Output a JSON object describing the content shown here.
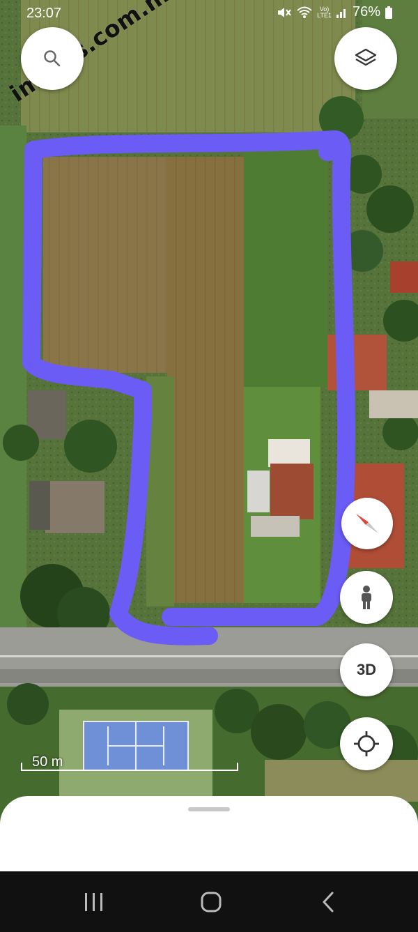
{
  "status_bar": {
    "time": "23:07",
    "battery_percent": "76%",
    "network_label_top": "Vo)",
    "network_label_bottom": "LTE1",
    "icons": [
      "mute-icon",
      "wifi-icon",
      "volte-icon",
      "signal-icon",
      "battery-icon"
    ]
  },
  "watermark": {
    "text": "impuls.com.mk"
  },
  "map": {
    "type": "satellite",
    "outline_color": "#6b5cf5",
    "court_color": "#6f8fd6"
  },
  "controls": {
    "search_icon": "search-icon",
    "layers_icon": "layers-icon",
    "compass_icon": "compass-icon",
    "street_view_icon": "pegman-icon",
    "three_d_label": "3D",
    "my_location_icon": "my-location-icon"
  },
  "scale": {
    "label": "50 m"
  },
  "nav_bar": {
    "icons": [
      "recents-icon",
      "home-icon",
      "back-icon"
    ]
  }
}
